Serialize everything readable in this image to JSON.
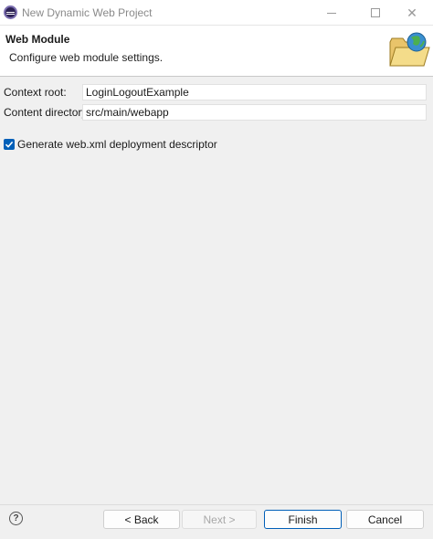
{
  "window": {
    "title": "New Dynamic Web Project",
    "minimize_icon": "minimize-icon",
    "maximize_icon": "maximize-icon",
    "close_glyph": "✕"
  },
  "header": {
    "title": "Web Module",
    "description": "Configure web module settings.",
    "banner_icon": "folder-globe-icon"
  },
  "form": {
    "context_root": {
      "label": "Context root:",
      "value": "LoginLogoutExample"
    },
    "content_directory": {
      "label": "Content directory:",
      "value": "src/main/webapp"
    },
    "generate_descriptor": {
      "label": "Generate web.xml deployment descriptor",
      "checked": true
    }
  },
  "footer": {
    "help_glyph": "?",
    "back_label": "< Back",
    "next_label": "Next >",
    "finish_label": "Finish",
    "cancel_label": "Cancel"
  },
  "colors": {
    "accent": "#005fb8",
    "background": "#f0f0f0"
  }
}
